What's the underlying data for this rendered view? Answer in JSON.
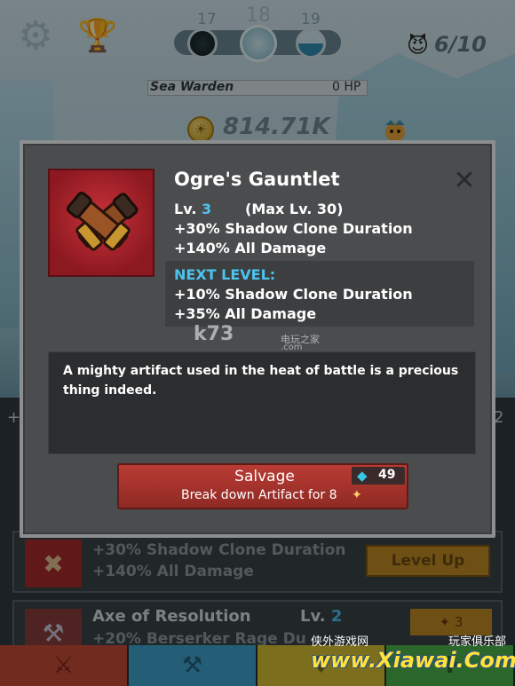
{
  "hud": {
    "stages": {
      "prev": "17",
      "current": "18",
      "next": "19"
    },
    "kills": "6/10",
    "boss": {
      "name": "Sea Warden",
      "hp": "0 HP"
    },
    "gold": "814.71K"
  },
  "modal": {
    "title": "Ogre's Gauntlet",
    "close": "✕",
    "level_label": "Lv.",
    "level": "3",
    "max_level": "(Max Lv. 30)",
    "effects": [
      "+30% Shadow Clone Duration",
      "+140% All Damage"
    ],
    "next_level_title": "NEXT LEVEL:",
    "next_effects": [
      "+10% Shadow Clone Duration",
      "+35% All Damage"
    ],
    "description": "A mighty artifact used in the heat of battle is a precious thing indeed.",
    "salvage": {
      "label": "Salvage",
      "cost": "49",
      "sub": "Break down Artifact for 8"
    }
  },
  "list": {
    "header_left": "+",
    "header_right": "2",
    "rows": [
      {
        "effects": [
          "+30% Shadow Clone Duration",
          "+140% All Damage"
        ],
        "button": "Level Up"
      },
      {
        "title": "Axe of Resolution",
        "level_label": "Lv.",
        "level": "2",
        "effect": "+20% Berserker Rage Du",
        "cost": "3"
      }
    ]
  },
  "watermarks": {
    "k73": "k73",
    "k73_cn": "电玩之家",
    "k73_com": ".com",
    "xiawai_cn": "侠外游戏网",
    "xiawai_cn2": "玩家俱乐部",
    "xiawai": "www.Xiawai.Com"
  },
  "colors": {
    "accent_blue": "#4dc3ec",
    "salvage_red": "#b93c34",
    "level_up_gold": "#c08a24",
    "modal_bg": "#4a4c4e"
  },
  "icons": [
    "gear-icon",
    "trophy-icon",
    "demon-icon",
    "coin-icon",
    "close-icon",
    "diamond-icon",
    "relic-icon",
    "sword-icon",
    "heroes-icon",
    "artifact-icon",
    "shop-icon"
  ]
}
